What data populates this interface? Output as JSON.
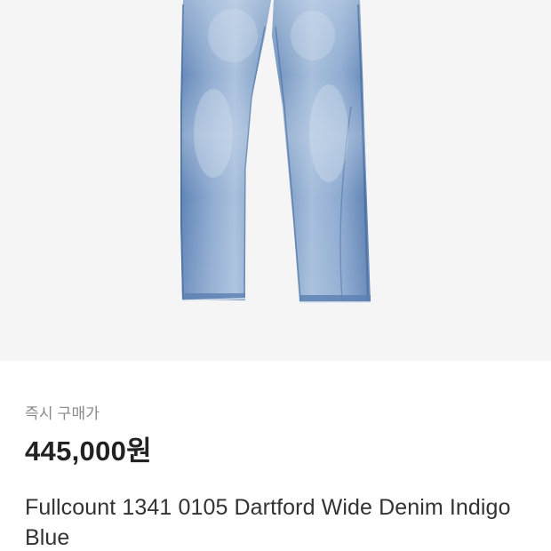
{
  "product": {
    "image_alt": "jeans-photo",
    "price_label": "즉시 구매가",
    "price": "445,000원",
    "title": "Fullcount 1341 0105 Dartford Wide Denim Indigo Blue"
  },
  "colors": {
    "image_background": "#f5f5f5",
    "denim_light": "#9fb9d6",
    "denim_mid": "#6e91bd",
    "denim_dark": "#4c72a6",
    "price_label": "#888888",
    "price": "#222222",
    "title": "#333333"
  }
}
